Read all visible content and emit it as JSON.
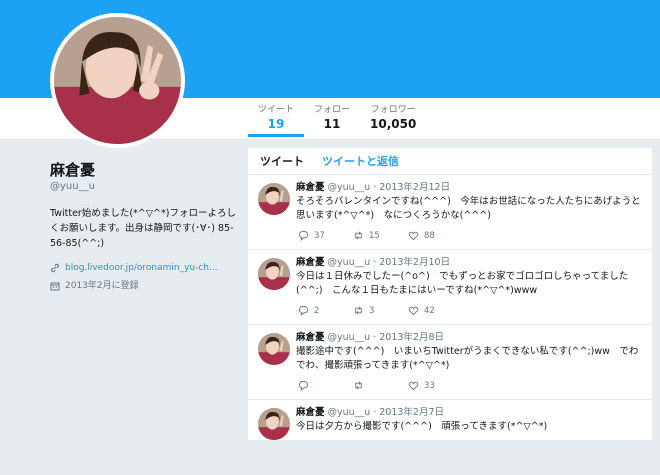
{
  "profile": {
    "name": "麻倉憂",
    "handle": "@yuu__u",
    "bio": "Twitter始めました(*^▽^*)フォローよろしくお願いします。出身は静岡です(･∀･) 85-56-85(^^;)",
    "link": "blog.livedoor.jp/oronamin_yu-ch...",
    "joined": "2013年2月に登録"
  },
  "stats": [
    {
      "label": "ツイート",
      "value": "19"
    },
    {
      "label": "フォロー",
      "value": "11"
    },
    {
      "label": "フォロワー",
      "value": "10,050"
    }
  ],
  "timeline_tabs": [
    "ツイート",
    "ツイートと返信"
  ],
  "tweets": [
    {
      "name": "麻倉憂",
      "meta": "@yuu__u · 2013年2月12日",
      "text": "そろそろバレンタインですね(^^^)　今年はお世話になった人たちにあげようと思います(*^▽^*)　なにつくろうかな(^^^)",
      "replies": "37",
      "retweets": "15",
      "likes": "88"
    },
    {
      "name": "麻倉憂",
      "meta": "@yuu__u · 2013年2月10日",
      "text": "今日は１日休みでしたー(^o^)　でもずっとお家でゴロゴロしちゃってました(^^;)　こんな１日もたまにはいーですね(*^▽^*)www",
      "replies": "2",
      "retweets": "3",
      "likes": "42"
    },
    {
      "name": "麻倉憂",
      "meta": "@yuu__u · 2013年2月8日",
      "text": "撮影途中です(^^^)　いまいちTwitterがうまくできない私です(^^;)ww　でわでわ、撮影頑張ってきます(*^▽^*)",
      "replies": "",
      "retweets": "",
      "likes": "33"
    },
    {
      "name": "麻倉憂",
      "meta": "@yuu__u · 2013年2月7日",
      "text": "今日は夕方から撮影です(^^^)　頑張ってきます(*^▽^*)",
      "replies": "",
      "retweets": "",
      "likes": ""
    }
  ],
  "colors": {
    "accent": "#1da1f2",
    "muted": "#657786",
    "background": "#e6ecf0"
  }
}
